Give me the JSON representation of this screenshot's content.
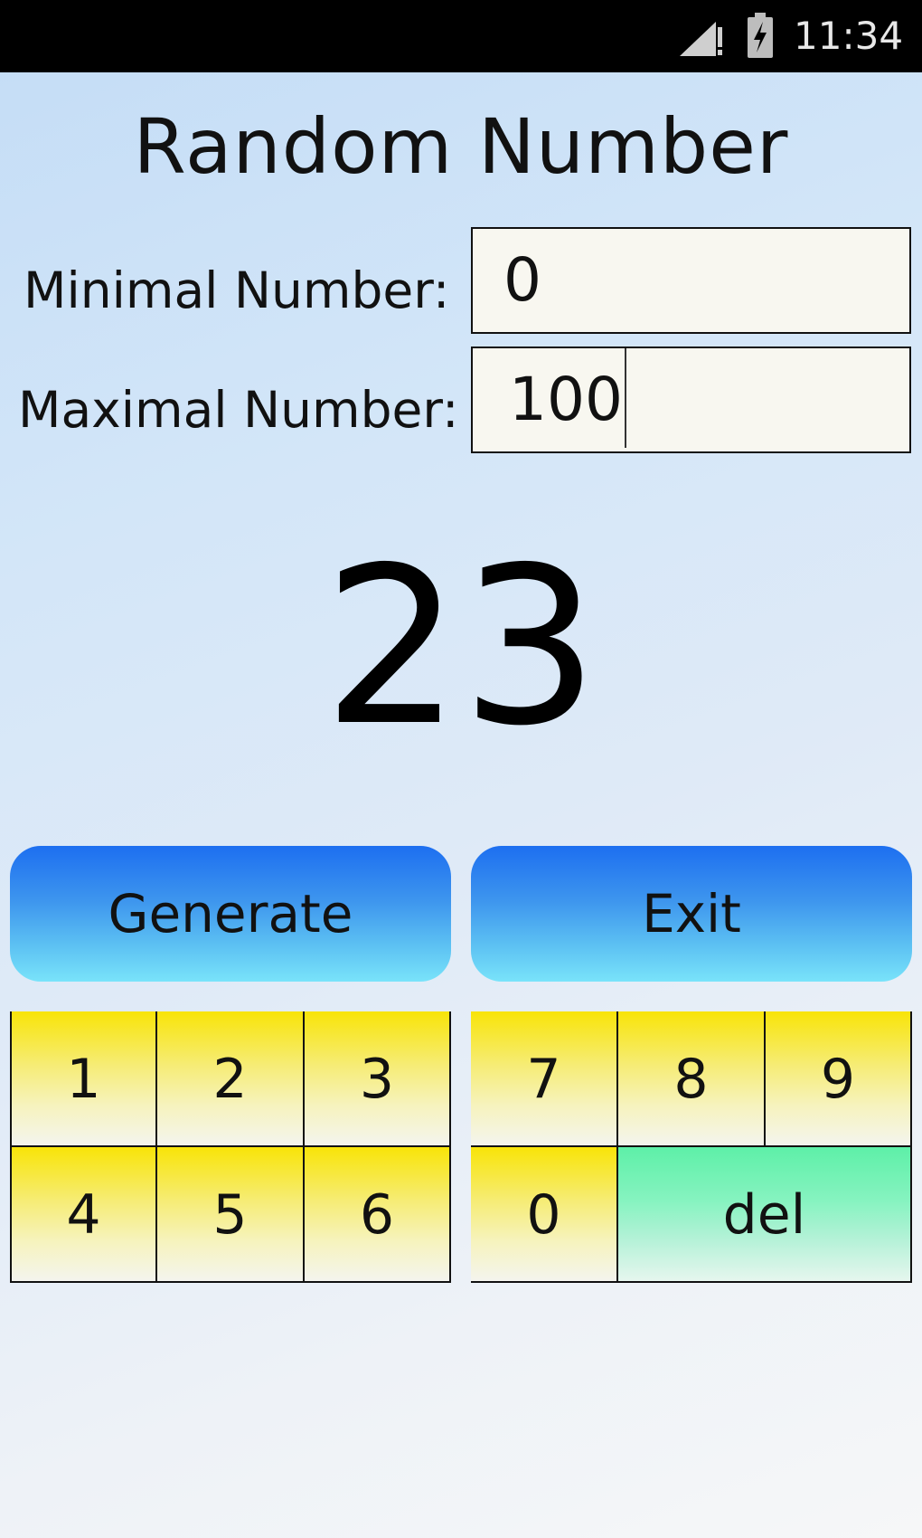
{
  "status_bar": {
    "time": "11:34",
    "icons": [
      "signal-alert-icon",
      "battery-charging-icon"
    ]
  },
  "title": "Random Number",
  "min_field": {
    "label": "Minimal Number:",
    "value": "0"
  },
  "max_field": {
    "label": "Maximal Number:",
    "value": "100"
  },
  "result": "23",
  "buttons": {
    "generate": "Generate",
    "exit": "Exit"
  },
  "keypad": {
    "k1": "1",
    "k2": "2",
    "k3": "3",
    "k4": "4",
    "k5": "5",
    "k6": "6",
    "k7": "7",
    "k8": "8",
    "k9": "9",
    "k0": "0",
    "del": "del"
  },
  "colors": {
    "action_top": "#1d6ff0",
    "action_bottom": "#79e3fa",
    "key_top": "#f8e408",
    "del_top": "#5ef0a8"
  }
}
